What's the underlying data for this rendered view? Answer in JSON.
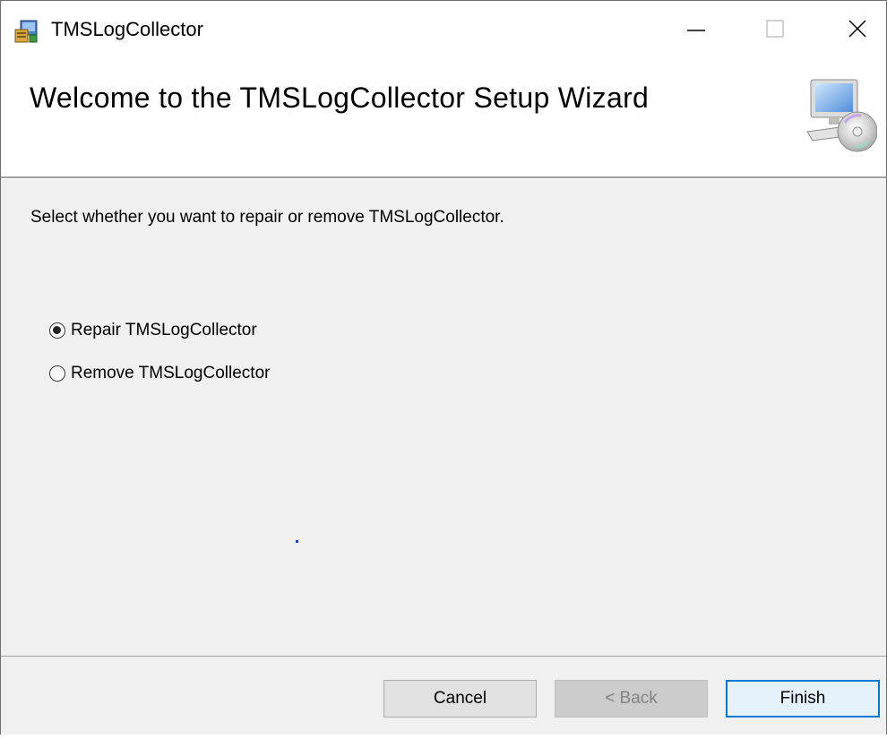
{
  "window": {
    "title": "TMSLogCollector",
    "minimize_icon": "minimize-icon",
    "maximize_icon": "maximize-icon",
    "close_icon": "close-icon"
  },
  "banner": {
    "title": "Welcome to the TMSLogCollector Setup Wizard",
    "graphic": "computer-cd-icon"
  },
  "content": {
    "instruction": "Select whether you want to repair or remove TMSLogCollector.",
    "options": [
      {
        "label": "Repair TMSLogCollector",
        "selected": true
      },
      {
        "label": "Remove TMSLogCollector",
        "selected": false
      }
    ]
  },
  "buttons": {
    "cancel": "Cancel",
    "back": "< Back",
    "finish": "Finish",
    "back_enabled": false,
    "default": "finish"
  },
  "colors": {
    "accent": "#0078d7",
    "content_bg": "#f0f0f0"
  }
}
